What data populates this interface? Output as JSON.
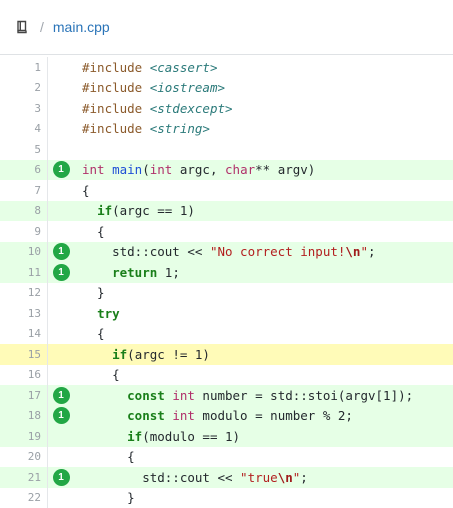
{
  "header": {
    "file_name": "main.cpp",
    "separator": "/"
  },
  "code": {
    "lines": [
      {
        "num": "1",
        "cov": "",
        "hits": "",
        "tokens": [
          {
            "t": "#include ",
            "c": "pp"
          },
          {
            "t": "<cassert>",
            "c": "inc"
          }
        ]
      },
      {
        "num": "2",
        "cov": "",
        "hits": "",
        "tokens": [
          {
            "t": "#include ",
            "c": "pp"
          },
          {
            "t": "<iostream>",
            "c": "inc"
          }
        ]
      },
      {
        "num": "3",
        "cov": "",
        "hits": "",
        "tokens": [
          {
            "t": "#include ",
            "c": "pp"
          },
          {
            "t": "<stdexcept>",
            "c": "inc"
          }
        ]
      },
      {
        "num": "4",
        "cov": "",
        "hits": "",
        "tokens": [
          {
            "t": "#include ",
            "c": "pp"
          },
          {
            "t": "<string>",
            "c": "inc"
          }
        ]
      },
      {
        "num": "5",
        "cov": "",
        "hits": "",
        "tokens": []
      },
      {
        "num": "6",
        "cov": "covered",
        "hits": "1",
        "tokens": [
          {
            "t": "int",
            "c": "ty"
          },
          {
            "t": " "
          },
          {
            "t": "main",
            "c": "fn"
          },
          {
            "t": "("
          },
          {
            "t": "int",
            "c": "ty"
          },
          {
            "t": " argc, "
          },
          {
            "t": "char",
            "c": "ty"
          },
          {
            "t": "** argv)"
          }
        ]
      },
      {
        "num": "7",
        "cov": "",
        "hits": "",
        "tokens": [
          {
            "t": "{"
          }
        ]
      },
      {
        "num": "8",
        "cov": "covered",
        "hits": "",
        "tokens": [
          {
            "t": "  "
          },
          {
            "t": "if",
            "c": "kw"
          },
          {
            "t": "(argc == "
          },
          {
            "t": "1",
            "c": "num"
          },
          {
            "t": ")"
          }
        ]
      },
      {
        "num": "9",
        "cov": "",
        "hits": "",
        "tokens": [
          {
            "t": "  {"
          }
        ]
      },
      {
        "num": "10",
        "cov": "covered",
        "hits": "1",
        "tokens": [
          {
            "t": "    std::cout << "
          },
          {
            "t": "\"No correct input!",
            "c": "str"
          },
          {
            "t": "\\n",
            "c": "esc"
          },
          {
            "t": "\"",
            "c": "str"
          },
          {
            "t": ";"
          }
        ]
      },
      {
        "num": "11",
        "cov": "covered",
        "hits": "1",
        "tokens": [
          {
            "t": "    "
          },
          {
            "t": "return",
            "c": "kw"
          },
          {
            "t": " 1;"
          }
        ]
      },
      {
        "num": "12",
        "cov": "",
        "hits": "",
        "tokens": [
          {
            "t": "  }"
          }
        ]
      },
      {
        "num": "13",
        "cov": "",
        "hits": "",
        "tokens": [
          {
            "t": "  "
          },
          {
            "t": "try",
            "c": "kw"
          }
        ]
      },
      {
        "num": "14",
        "cov": "",
        "hits": "",
        "tokens": [
          {
            "t": "  {"
          }
        ]
      },
      {
        "num": "15",
        "cov": "partial",
        "hits": "",
        "tokens": [
          {
            "t": "    "
          },
          {
            "t": "if",
            "c": "kw"
          },
          {
            "t": "(argc != 1)"
          }
        ]
      },
      {
        "num": "16",
        "cov": "",
        "hits": "",
        "tokens": [
          {
            "t": "    {"
          }
        ]
      },
      {
        "num": "17",
        "cov": "covered",
        "hits": "1",
        "tokens": [
          {
            "t": "      "
          },
          {
            "t": "const",
            "c": "kw"
          },
          {
            "t": " "
          },
          {
            "t": "int",
            "c": "ty"
          },
          {
            "t": " number = std::stoi(argv[1]);"
          }
        ]
      },
      {
        "num": "18",
        "cov": "covered",
        "hits": "1",
        "tokens": [
          {
            "t": "      "
          },
          {
            "t": "const",
            "c": "kw"
          },
          {
            "t": " "
          },
          {
            "t": "int",
            "c": "ty"
          },
          {
            "t": " modulo = number % 2;"
          }
        ]
      },
      {
        "num": "19",
        "cov": "covered",
        "hits": "",
        "tokens": [
          {
            "t": "      "
          },
          {
            "t": "if",
            "c": "kw"
          },
          {
            "t": "(modulo == 1)"
          }
        ]
      },
      {
        "num": "20",
        "cov": "",
        "hits": "",
        "tokens": [
          {
            "t": "      {"
          }
        ]
      },
      {
        "num": "21",
        "cov": "covered",
        "hits": "1",
        "tokens": [
          {
            "t": "        std::cout << "
          },
          {
            "t": "\"true",
            "c": "str"
          },
          {
            "t": "\\n",
            "c": "esc"
          },
          {
            "t": "\"",
            "c": "str"
          },
          {
            "t": ";"
          }
        ]
      },
      {
        "num": "22",
        "cov": "",
        "hits": "",
        "tokens": [
          {
            "t": "      }"
          }
        ]
      }
    ]
  },
  "colors": {
    "covered_bg": "#e6ffe6",
    "partial_bg": "#fffbb8",
    "hit_badge": "#22a745",
    "link": "#2a74b8"
  }
}
